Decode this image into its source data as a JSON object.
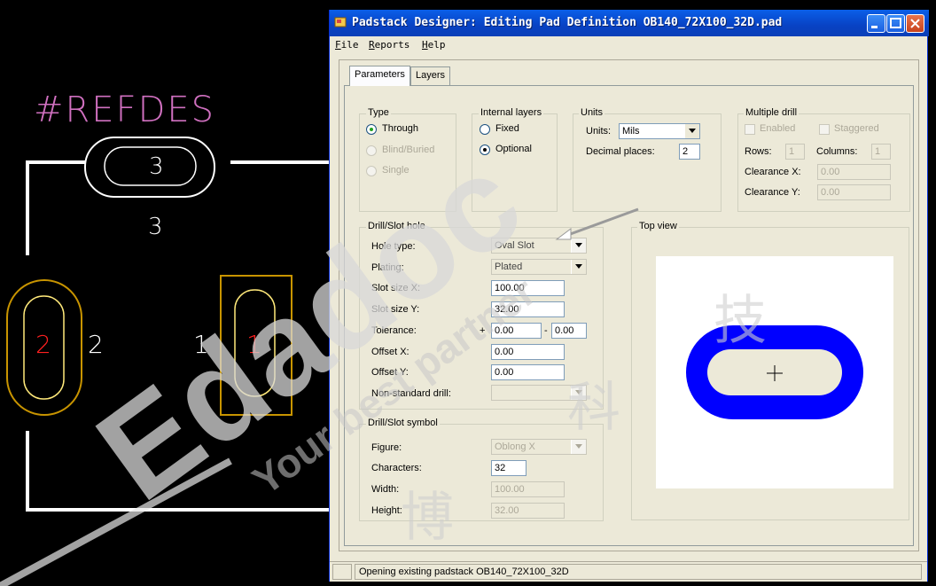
{
  "cad": {
    "refdes": "#REFDES",
    "pad_top_number": "3",
    "pad_top_label": "3",
    "pad_left_number": "2",
    "pad_left_label": "2",
    "pad_right_number": "1",
    "pad_right_label": "1"
  },
  "window": {
    "title": "Padstack Designer: Editing Pad Definition OB140_72X100_32D.pad",
    "menu": [
      "File",
      "Reports",
      "Help"
    ]
  },
  "tabs": [
    {
      "label": "Parameters",
      "active": true
    },
    {
      "label": "Layers",
      "active": false
    }
  ],
  "type_group": {
    "title": "Type",
    "options": [
      {
        "label": "Through",
        "selected": true,
        "enabled": true
      },
      {
        "label": "Blind/Buried",
        "selected": false,
        "enabled": false
      },
      {
        "label": "Single",
        "selected": false,
        "enabled": false
      }
    ]
  },
  "internal_layers": {
    "title": "Internal layers",
    "options": [
      {
        "label": "Fixed",
        "selected": false
      },
      {
        "label": "Optional",
        "selected": true
      }
    ]
  },
  "units": {
    "title": "Units",
    "units_label": "Units:",
    "units_value": "Mils",
    "decimal_label": "Decimal places:",
    "decimal_value": "2"
  },
  "multiple_drill": {
    "title": "Multiple drill",
    "enabled_label": "Enabled",
    "staggered_label": "Staggered",
    "rows_label": "Rows:",
    "rows_value": "1",
    "columns_label": "Columns:",
    "columns_value": "1",
    "clearance_x_label": "Clearance X:",
    "clearance_x_value": "0.00",
    "clearance_y_label": "Clearance Y:",
    "clearance_y_value": "0.00"
  },
  "drill_slot_hole": {
    "title": "Drill/Slot hole",
    "hole_type_label": "Hole type:",
    "hole_type_value": "Oval Slot",
    "plating_label": "Plating:",
    "plating_value": "Plated",
    "slot_x_label": "Slot size X:",
    "slot_x_value": "100.00",
    "slot_y_label": "Slot size Y:",
    "slot_y_value": "32.00",
    "tolerance_label": "Tolerance:",
    "tol_plus_sign": "+",
    "tol_plus_value": "0.00",
    "tol_minus_sign": "-",
    "tol_minus_value": "0.00",
    "offset_x_label": "Offset X:",
    "offset_x_value": "0.00",
    "offset_y_label": "Offset Y:",
    "offset_y_value": "0.00",
    "nonstandard_label": "Non-standard drill:",
    "nonstandard_value": ""
  },
  "drill_slot_symbol": {
    "title": "Drill/Slot symbol",
    "figure_label": "Figure:",
    "figure_value": "Oblong X",
    "characters_label": "Characters:",
    "characters_value": "32",
    "width_label": "Width:",
    "width_value": "100.00",
    "height_label": "Height:",
    "height_value": "32.00"
  },
  "top_view": {
    "title": "Top view"
  },
  "status": {
    "text": "Opening existing padstack OB140_72X100_32D"
  },
  "watermark": {
    "brand": "Edadoc",
    "slogan": "Your best partner",
    "cn1": "博",
    "cn2": "科",
    "cn3": "技"
  },
  "colors": {
    "titlebar": "#0842c4",
    "pad_fill": "#0000ff",
    "dialog_bg": "#ece9d8",
    "refdes": "#d070c0",
    "pad_outline_yellow": "#ffd700",
    "pad_number_red": "#ff2020"
  }
}
